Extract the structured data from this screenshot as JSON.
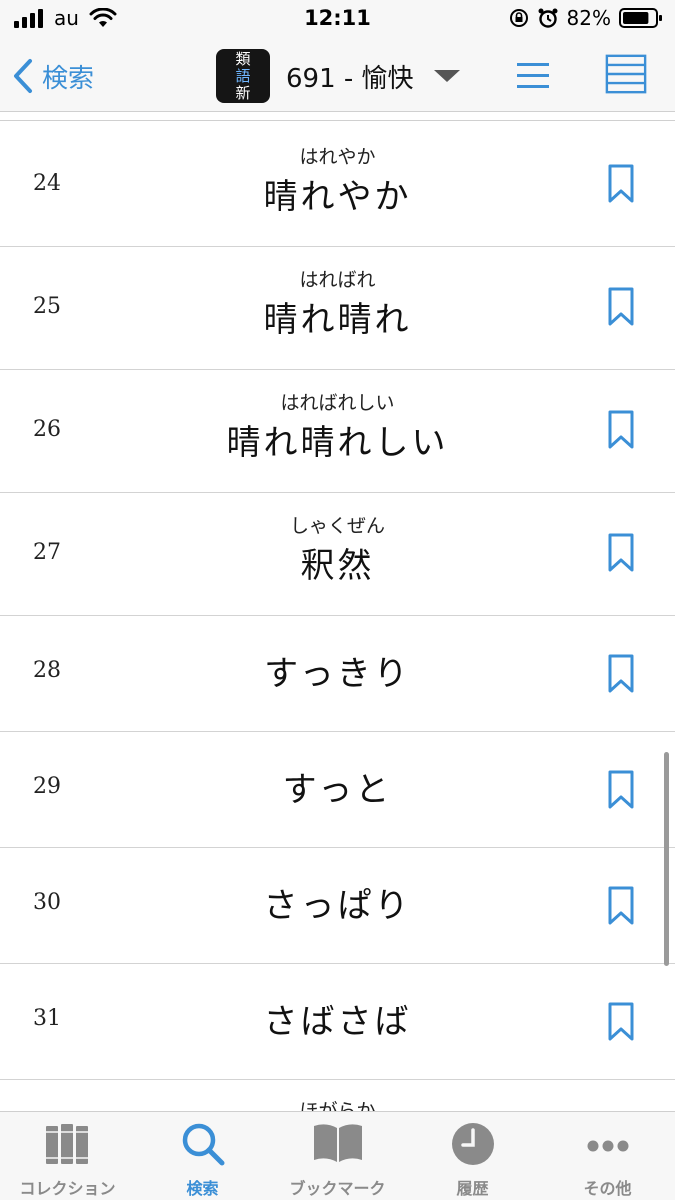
{
  "status_bar": {
    "carrier": "au",
    "time": "12:11",
    "battery_percent": "82%",
    "battery_level": 0.82
  },
  "nav": {
    "back_label": "検索",
    "logo_chars": [
      "類",
      "語",
      "新"
    ],
    "title": "691 - 愉快",
    "icons": [
      "back-chevron-icon",
      "caret-down-icon",
      "list-icon",
      "table-icon"
    ]
  },
  "entries": [
    {
      "number": "24",
      "reading": "はれやか",
      "word": "晴れやか"
    },
    {
      "number": "25",
      "reading": "はればれ",
      "word": "晴れ晴れ"
    },
    {
      "number": "26",
      "reading": "はればれしい",
      "word": "晴れ晴れしい"
    },
    {
      "number": "27",
      "reading": "しゃくぜん",
      "word": "釈然"
    },
    {
      "number": "28",
      "reading": "",
      "word": "すっきり"
    },
    {
      "number": "29",
      "reading": "",
      "word": "すっと"
    },
    {
      "number": "30",
      "reading": "",
      "word": "さっぱり"
    },
    {
      "number": "31",
      "reading": "",
      "word": "さばさば"
    }
  ],
  "peek_reading": "ほがらか",
  "tabs": [
    {
      "label": "コレクション",
      "icon": "books-icon",
      "active": false
    },
    {
      "label": "検索",
      "icon": "search-icon",
      "active": true
    },
    {
      "label": "ブックマーク",
      "icon": "open-book-icon",
      "active": false
    },
    {
      "label": "履歴",
      "icon": "clock-icon",
      "active": false
    },
    {
      "label": "その他",
      "icon": "more-icon",
      "active": false
    }
  ],
  "colors": {
    "accent": "#3b8fd6",
    "inactive": "#8a8a8a",
    "bar_background": "#f7f7f7"
  }
}
